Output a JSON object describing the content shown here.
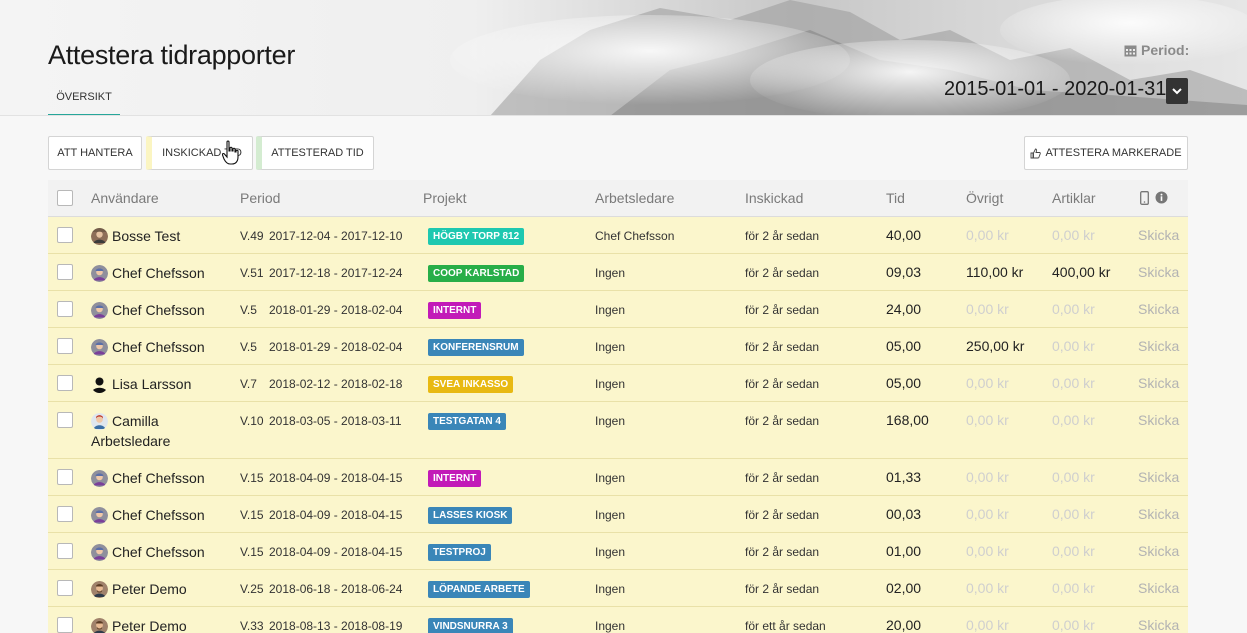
{
  "page": {
    "title": "Attestera tidrapporter"
  },
  "tabs": {
    "overview": "ÖVERSIKT"
  },
  "period": {
    "label": "Period:",
    "value": "2015-01-01 - 2020-01-31"
  },
  "toolbar": {
    "att_hantera": "ATT HANTERA",
    "inskickad_tid": "INSKICKAD TID",
    "attesterad_tid": "ATTESTERAD TID",
    "attestera_markerade": "ATTESTERA MARKERADE"
  },
  "colors": {
    "tab_underline": "#26a69a",
    "row_highlight": "#fbf6cc",
    "inskickad_marker": "#fbf5c2",
    "attesterad_marker": "#d4ecd1"
  },
  "table": {
    "headers": [
      "Användare",
      "Period",
      "Projekt",
      "Arbetsledare",
      "Inskickad",
      "Tid",
      "Övrigt",
      "Artiklar"
    ],
    "header_icons": [
      "phone-icon",
      "info-icon"
    ],
    "rows": [
      {
        "user": "Bosse Test",
        "week": "V.49",
        "range": "2017-12-04 - 2017-12-10",
        "project": "HÖGBY TORP 812",
        "project_color": "#1ec8b0",
        "leader": "Chef Chefsson",
        "submitted": "för 2 år sedan",
        "time": "40,00",
        "other": "0,00 kr",
        "articles": "0,00 kr",
        "action": "Skicka",
        "other_muted": true,
        "articles_muted": true,
        "avatar": "photo"
      },
      {
        "user": "Chef Chefsson",
        "week": "V.51",
        "range": "2017-12-18 - 2017-12-24",
        "project": "COOP KARLSTAD",
        "project_color": "#27ae48",
        "leader": "Ingen",
        "submitted": "för 2 år sedan",
        "time": "09,03",
        "other": "110,00 kr",
        "articles": "400,00 kr",
        "action": "Skicka",
        "other_muted": false,
        "articles_muted": false,
        "avatar": "chef"
      },
      {
        "user": "Chef Chefsson",
        "week": "V.5",
        "range": "2018-01-29 - 2018-02-04",
        "project": "INTERNT",
        "project_color": "#c21ab8",
        "leader": "Ingen",
        "submitted": "för 2 år sedan",
        "time": "24,00",
        "other": "0,00 kr",
        "articles": "0,00 kr",
        "action": "Skicka",
        "other_muted": true,
        "articles_muted": true,
        "avatar": "chef"
      },
      {
        "user": "Chef Chefsson",
        "week": "V.5",
        "range": "2018-01-29 - 2018-02-04",
        "project": "KONFERENSRUM",
        "project_color": "#3a86b8",
        "leader": "Ingen",
        "submitted": "för 2 år sedan",
        "time": "05,00",
        "other": "250,00 kr",
        "articles": "0,00 kr",
        "action": "Skicka",
        "other_muted": false,
        "articles_muted": true,
        "avatar": "chef"
      },
      {
        "user": "Lisa Larsson",
        "week": "V.7",
        "range": "2018-02-12 - 2018-02-18",
        "project": "SVEA INKASSO",
        "project_color": "#e8b912",
        "leader": "Ingen",
        "submitted": "för 2 år sedan",
        "time": "05,00",
        "other": "0,00 kr",
        "articles": "0,00 kr",
        "action": "Skicka",
        "other_muted": true,
        "articles_muted": true,
        "avatar": "silhouette"
      },
      {
        "user": "Camilla Arbetsledare",
        "week": "V.10",
        "range": "2018-03-05 - 2018-03-11",
        "project": "TESTGATAN 4",
        "project_color": "#3a86b8",
        "leader": "Ingen",
        "submitted": "för 2 år sedan",
        "time": "168,00",
        "other": "0,00 kr",
        "articles": "0,00 kr",
        "action": "Skicka",
        "other_muted": true,
        "articles_muted": true,
        "avatar": "camilla",
        "tall": true
      },
      {
        "user": "Chef Chefsson",
        "week": "V.15",
        "range": "2018-04-09 - 2018-04-15",
        "project": "INTERNT",
        "project_color": "#c21ab8",
        "leader": "Ingen",
        "submitted": "för 2 år sedan",
        "time": "01,33",
        "other": "0,00 kr",
        "articles": "0,00 kr",
        "action": "Skicka",
        "other_muted": true,
        "articles_muted": true,
        "avatar": "chef"
      },
      {
        "user": "Chef Chefsson",
        "week": "V.15",
        "range": "2018-04-09 - 2018-04-15",
        "project": "LASSES KIOSK",
        "project_color": "#3a86b8",
        "leader": "Ingen",
        "submitted": "för 2 år sedan",
        "time": "00,03",
        "other": "0,00 kr",
        "articles": "0,00 kr",
        "action": "Skicka",
        "other_muted": true,
        "articles_muted": true,
        "avatar": "chef"
      },
      {
        "user": "Chef Chefsson",
        "week": "V.15",
        "range": "2018-04-09 - 2018-04-15",
        "project": "TESTPROJ",
        "project_color": "#3a86b8",
        "leader": "Ingen",
        "submitted": "för 2 år sedan",
        "time": "01,00",
        "other": "0,00 kr",
        "articles": "0,00 kr",
        "action": "Skicka",
        "other_muted": true,
        "articles_muted": true,
        "avatar": "chef"
      },
      {
        "user": "Peter Demo",
        "week": "V.25",
        "range": "2018-06-18 - 2018-06-24",
        "project": "LÖPANDE ARBETE",
        "project_color": "#3a86b8",
        "leader": "Ingen",
        "submitted": "för 2 år sedan",
        "time": "02,00",
        "other": "0,00 kr",
        "articles": "0,00 kr",
        "action": "Skicka",
        "other_muted": true,
        "articles_muted": true,
        "avatar": "peter"
      },
      {
        "user": "Peter Demo",
        "week": "V.33",
        "range": "2018-08-13 - 2018-08-19",
        "project": "VINDSNURRA 3",
        "project_color": "#3a86b8",
        "leader": "Ingen",
        "submitted": "för ett år sedan",
        "time": "20,00",
        "other": "0,00 kr",
        "articles": "0,00 kr",
        "action": "Skicka",
        "other_muted": true,
        "articles_muted": true,
        "avatar": "peter"
      }
    ]
  }
}
